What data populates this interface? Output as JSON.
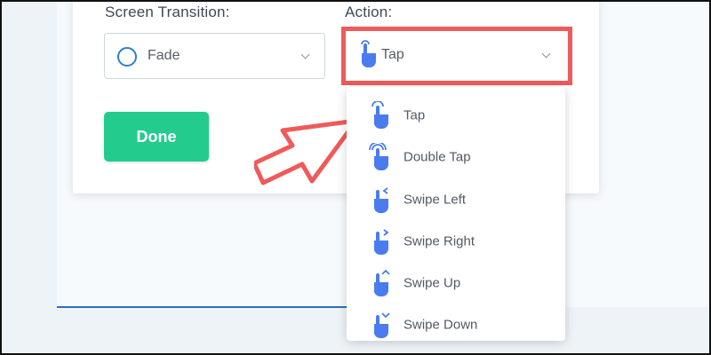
{
  "screen_transition": {
    "label": "Screen Transition:",
    "value": "Fade"
  },
  "action": {
    "label": "Action:",
    "value": "Tap"
  },
  "done_button": "Done",
  "dropdown_options": [
    "Tap",
    "Double Tap",
    "Swipe Left",
    "Swipe Right",
    "Swipe Up",
    "Swipe Down"
  ],
  "colors": {
    "accent_blue": "#4a7cf0",
    "done_green": "#23cc8c",
    "highlight_red": "#ef5a5a",
    "circle_blue": "#2b7fd1"
  },
  "icons": [
    "circle-icon",
    "tap-hand-icon",
    "double-tap-hand-icon",
    "swipe-left-hand-icon",
    "swipe-right-hand-icon",
    "swipe-up-hand-icon",
    "swipe-down-hand-icon",
    "chevron-down-icon",
    "pointer-arrow-icon"
  ]
}
